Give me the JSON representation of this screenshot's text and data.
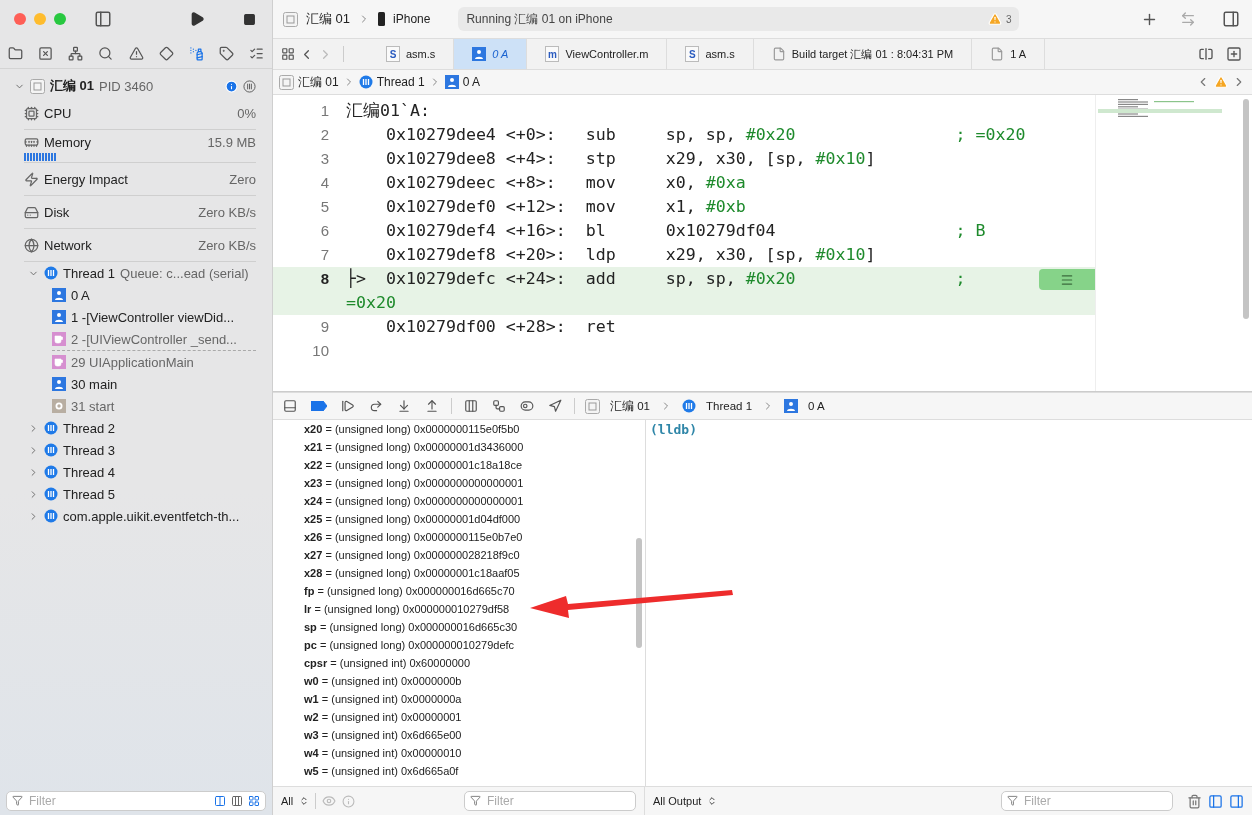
{
  "toolbar": {
    "scheme": "汇编 01",
    "destination": "iPhone",
    "status": "Running 汇编 01 on iPhone",
    "warning_count": "3"
  },
  "navigator_tabs": [
    {
      "kind": "folder",
      "selected": false
    },
    {
      "kind": "source-control",
      "selected": false
    },
    {
      "kind": "hierarchy",
      "selected": false
    },
    {
      "kind": "search",
      "selected": false
    },
    {
      "kind": "issues",
      "selected": false
    },
    {
      "kind": "tests",
      "selected": false
    },
    {
      "kind": "debug",
      "selected": true
    },
    {
      "kind": "breakpoints",
      "selected": false
    },
    {
      "kind": "reports",
      "selected": false
    }
  ],
  "sidebar": {
    "process": {
      "name": "汇编 01",
      "pid": "PID 3460"
    },
    "gauges": [
      {
        "kind": "cpu",
        "label": "CPU",
        "value": "0%"
      },
      {
        "kind": "memory",
        "label": "Memory",
        "value": "15.9 MB"
      },
      {
        "kind": "energy",
        "label": "Energy Impact",
        "value": "Zero"
      },
      {
        "kind": "disk",
        "label": "Disk",
        "value": "Zero KB/s"
      },
      {
        "kind": "network",
        "label": "Network",
        "value": "Zero KB/s"
      }
    ],
    "threads": [
      {
        "label": "Thread 1",
        "detail": "Queue: c...ead (serial)",
        "expanded": true,
        "children": [
          {
            "label": "0 A",
            "kind": "user",
            "gap_after": false
          },
          {
            "label": "1 -[ViewController viewDid...",
            "kind": "user",
            "gap_after": false
          },
          {
            "label": "2 -[UIViewController _send...",
            "kind": "library",
            "gap_after": true
          },
          {
            "label": "29 UIApplicationMain",
            "kind": "library",
            "gap_after": false
          },
          {
            "label": "30 main",
            "kind": "user",
            "gap_after": false
          },
          {
            "label": "31 start",
            "kind": "system",
            "gap_after": false
          }
        ]
      },
      {
        "label": "Thread 2",
        "expanded": false
      },
      {
        "label": "Thread 3",
        "expanded": false
      },
      {
        "label": "Thread 4",
        "expanded": false
      },
      {
        "label": "Thread 5",
        "expanded": false
      },
      {
        "label": "com.apple.uikit.eventfetch-th...",
        "expanded": false
      }
    ],
    "filter_placeholder": "Filter"
  },
  "editor_tabs": [
    {
      "label": "asm.s",
      "kind": "source",
      "icon_letter": "S",
      "selected": false
    },
    {
      "label": "0 A",
      "kind": "frame",
      "selected": true
    },
    {
      "label": "ViewController.m",
      "kind": "source",
      "icon_letter": "m",
      "selected": false
    },
    {
      "label": "asm.s",
      "kind": "source",
      "icon_letter": "S",
      "selected": false
    },
    {
      "label": "Build target 汇编 01 : 8:04:31 PM",
      "kind": "document",
      "selected": false
    },
    {
      "label": "1 A",
      "kind": "document",
      "selected": false
    }
  ],
  "breadcrumb": [
    {
      "label": "汇编 01",
      "kind": "project"
    },
    {
      "label": "Thread 1",
      "kind": "thread"
    },
    {
      "label": "0 A",
      "kind": "frame"
    }
  ],
  "code": {
    "lines": [
      {
        "number": "1",
        "kind": "label",
        "text": "汇编01`A:"
      },
      {
        "number": "2",
        "kind": "instruction",
        "address": "0x10279dee4",
        "offset": "<+0>:",
        "op": "sub",
        "operands": [
          {
            "text": "sp, sp, ",
            "kind": "reg"
          },
          {
            "text": "#0x20",
            "kind": "imm"
          }
        ],
        "comment": "; =0x20",
        "current": false
      },
      {
        "number": "3",
        "kind": "instruction",
        "address": "0x10279dee8",
        "offset": "<+4>:",
        "op": "stp",
        "operands": [
          {
            "text": "x29, x30, [sp, ",
            "kind": "reg"
          },
          {
            "text": "#0x10",
            "kind": "imm"
          },
          {
            "text": "]",
            "kind": "reg"
          }
        ],
        "current": false
      },
      {
        "number": "4",
        "kind": "instruction",
        "address": "0x10279deec",
        "offset": "<+8>:",
        "op": "mov",
        "operands": [
          {
            "text": "x0, ",
            "kind": "reg"
          },
          {
            "text": "#0xa",
            "kind": "imm"
          }
        ],
        "current": false
      },
      {
        "number": "5",
        "kind": "instruction",
        "address": "0x10279def0",
        "offset": "<+12>:",
        "op": "mov",
        "operands": [
          {
            "text": "x1, ",
            "kind": "reg"
          },
          {
            "text": "#0xb",
            "kind": "imm"
          }
        ],
        "current": false
      },
      {
        "number": "6",
        "kind": "instruction",
        "address": "0x10279def4",
        "offset": "<+16>:",
        "op": "bl",
        "operands": [
          {
            "text": "0x10279df04",
            "kind": "reg"
          }
        ],
        "comment": "; B",
        "current": false
      },
      {
        "number": "7",
        "kind": "instruction",
        "address": "0x10279def8",
        "offset": "<+20>:",
        "op": "ldp",
        "operands": [
          {
            "text": "x29, x30, [sp, ",
            "kind": "reg"
          },
          {
            "text": "#0x10",
            "kind": "imm"
          },
          {
            "text": "]",
            "kind": "reg"
          }
        ],
        "current": false
      },
      {
        "number": "8",
        "kind": "instruction",
        "marker": "├>",
        "address": "0x10279defc",
        "offset": "<+24>:",
        "op": "add",
        "operands": [
          {
            "text": "sp, sp, ",
            "kind": "reg"
          },
          {
            "text": "#0x20",
            "kind": "imm"
          }
        ],
        "comment": "; =0x20",
        "current": true
      },
      {
        "number": "9",
        "kind": "instruction",
        "address": "0x10279df00",
        "offset": "<+28>:",
        "op": "ret",
        "current": false
      },
      {
        "number": "10",
        "kind": "empty"
      }
    ]
  },
  "debug_bar": {
    "breakpoints_active": true,
    "breadcrumb": [
      {
        "label": "汇编 01",
        "kind": "project"
      },
      {
        "label": "Thread 1",
        "kind": "thread"
      },
      {
        "label": "0 A",
        "kind": "frame"
      }
    ]
  },
  "variables": [
    "**x20** = (unsigned long) 0x0000000115e0f5b0",
    "**x21** = (unsigned long) 0x00000001d3436000",
    "**x22** = (unsigned long) 0x00000001c18a18ce",
    "**x23** = (unsigned long) 0x0000000000000001",
    "**x24** = (unsigned long) 0x0000000000000001",
    "**x25** = (unsigned long) 0x00000001d04df000",
    "**x26** = (unsigned long) 0x0000000115e0b7e0",
    "**x27** = (unsigned long) 0x000000028218f9c0",
    "**x28** = (unsigned long) 0x00000001c18aaf05",
    "**fp** = (unsigned long) 0x000000016d665c70",
    "**lr** = (unsigned long) 0x000000010279df58",
    "**sp** = (unsigned long) 0x000000016d665c30",
    "**pc** = (unsigned long) 0x000000010279defc",
    "**cpsr** = (unsigned int) 0x60000000",
    "**w0** = (unsigned int) 0x0000000b",
    "**w1** = (unsigned int) 0x0000000a",
    "**w2** = (unsigned int) 0x00000001",
    "**w3** = (unsigned int) 0x6d665e00",
    "**w4** = (unsigned int) 0x00000010",
    "**w5** = (unsigned int) 0x6d665a0f"
  ],
  "variables_bar": {
    "scope": "All",
    "filter_placeholder": "Filter"
  },
  "console": {
    "prompt": "(lldb)"
  },
  "console_bar": {
    "output": "All Output",
    "filter_placeholder": "Filter"
  }
}
